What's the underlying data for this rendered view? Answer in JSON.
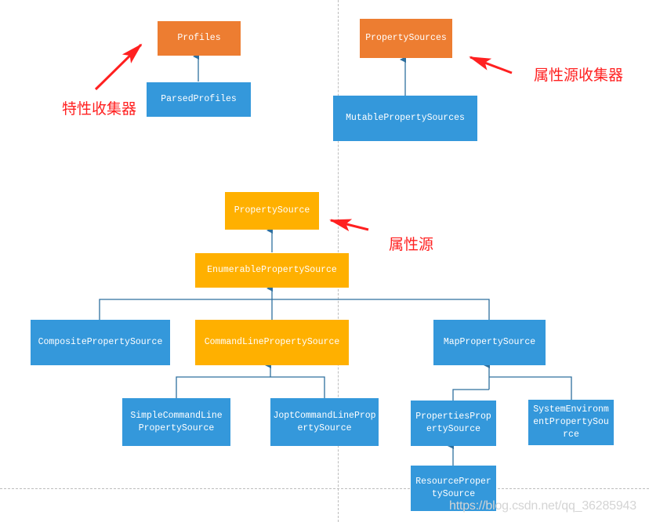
{
  "diagram": {
    "nodes": {
      "profiles": "Profiles",
      "parsed_profiles": "ParsedProfiles",
      "property_sources": "PropertySources",
      "mutable_property_sources": "MutablePropertySources",
      "property_source": "PropertySource",
      "enumerable_property_source": "EnumerablePropertySource",
      "composite_property_source": "CompositePropertySource",
      "command_line_property_source": "CommandLinePropertySource",
      "map_property_source": "MapPropertySource",
      "simple_command_line_property_source": "SimpleCommandLinePropertySource",
      "jopt_command_line_property_source": "JoptCommandLinePropertySource",
      "properties_property_source": "PropertiesPropertySource",
      "system_environment_property_source": "SystemEnvironmentPropertySource",
      "resource_property_source": "ResourcePropertySource"
    },
    "edges": [
      {
        "from": "ParsedProfiles",
        "to": "Profiles"
      },
      {
        "from": "MutablePropertySources",
        "to": "PropertySources"
      },
      {
        "from": "EnumerablePropertySource",
        "to": "PropertySource"
      },
      {
        "from": "CompositePropertySource",
        "to": "EnumerablePropertySource"
      },
      {
        "from": "CommandLinePropertySource",
        "to": "EnumerablePropertySource"
      },
      {
        "from": "MapPropertySource",
        "to": "EnumerablePropertySource"
      },
      {
        "from": "SimpleCommandLinePropertySource",
        "to": "CommandLinePropertySource"
      },
      {
        "from": "JoptCommandLinePropertySource",
        "to": "CommandLinePropertySource"
      },
      {
        "from": "PropertiesPropertySource",
        "to": "MapPropertySource"
      },
      {
        "from": "SystemEnvironmentPropertySource",
        "to": "MapPropertySource"
      },
      {
        "from": "ResourcePropertySource",
        "to": "PropertiesPropertySource"
      }
    ],
    "annotations": {
      "profiles_collector": "特性收集器",
      "property_sources_collector": "属性源收集器",
      "property_source": "属性源"
    },
    "colors": {
      "collector": "#ed7d31",
      "core": "#ffb000",
      "impl": "#3498db",
      "connector": "#2e6f9e",
      "annotation": "#ff2020"
    },
    "watermark": "https://blog.csdn.net/qq_36285943"
  }
}
